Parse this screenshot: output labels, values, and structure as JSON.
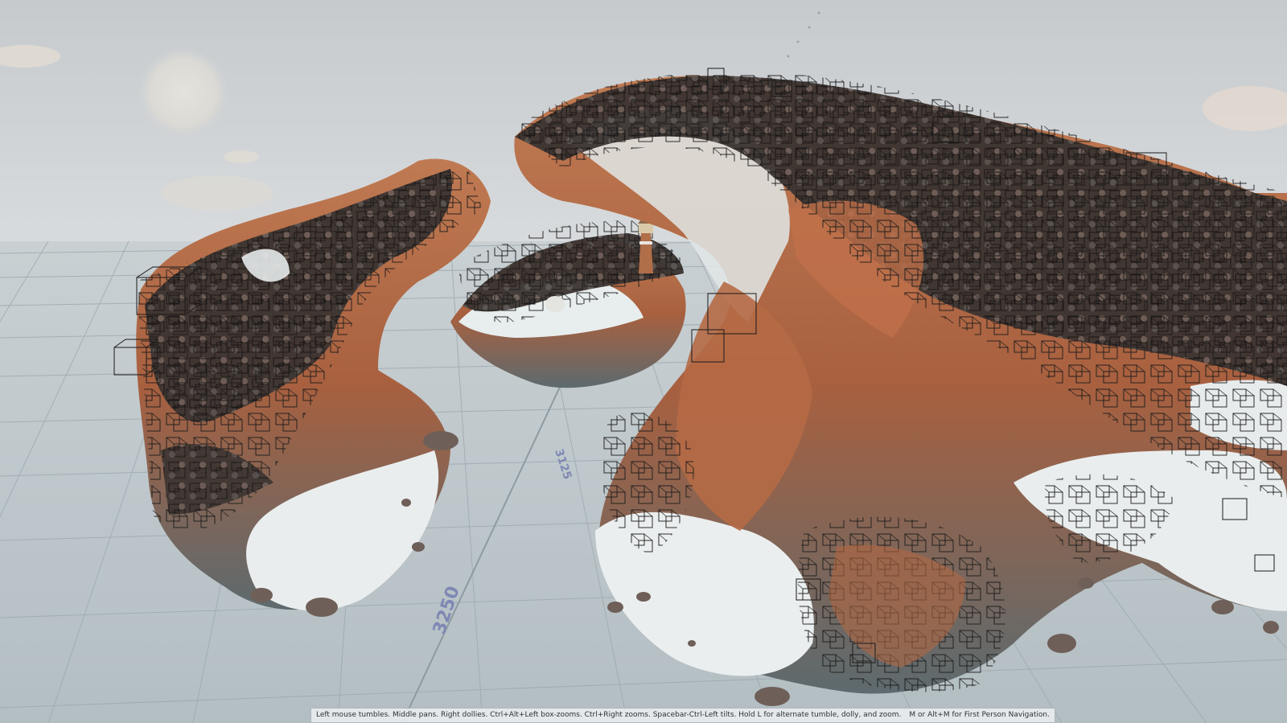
{
  "viewport": {
    "grid_labels": [
      "3125",
      "3250"
    ],
    "nav_hint": {
      "primary": "Left mouse tumbles. Middle pans. Right dollies. Ctrl+Alt+Left box-zooms. Ctrl+Right zooms. Spacebar-Ctrl-Left tilts. Hold L for alternate tumble, dolly, and zoom.",
      "secondary": "M or Alt+M for First Person Navigation."
    }
  },
  "colors": {
    "sky_top": "#c8ccd0",
    "sky_bottom": "#d9dcde",
    "ground": "#b9c3c8",
    "grid_line": "#9aa6ad",
    "rock": "#b86a46",
    "rock_dark": "#5c6b70",
    "snow": "#e9eded",
    "trees": "#2b2624",
    "grid_label": "#7f88b4"
  }
}
